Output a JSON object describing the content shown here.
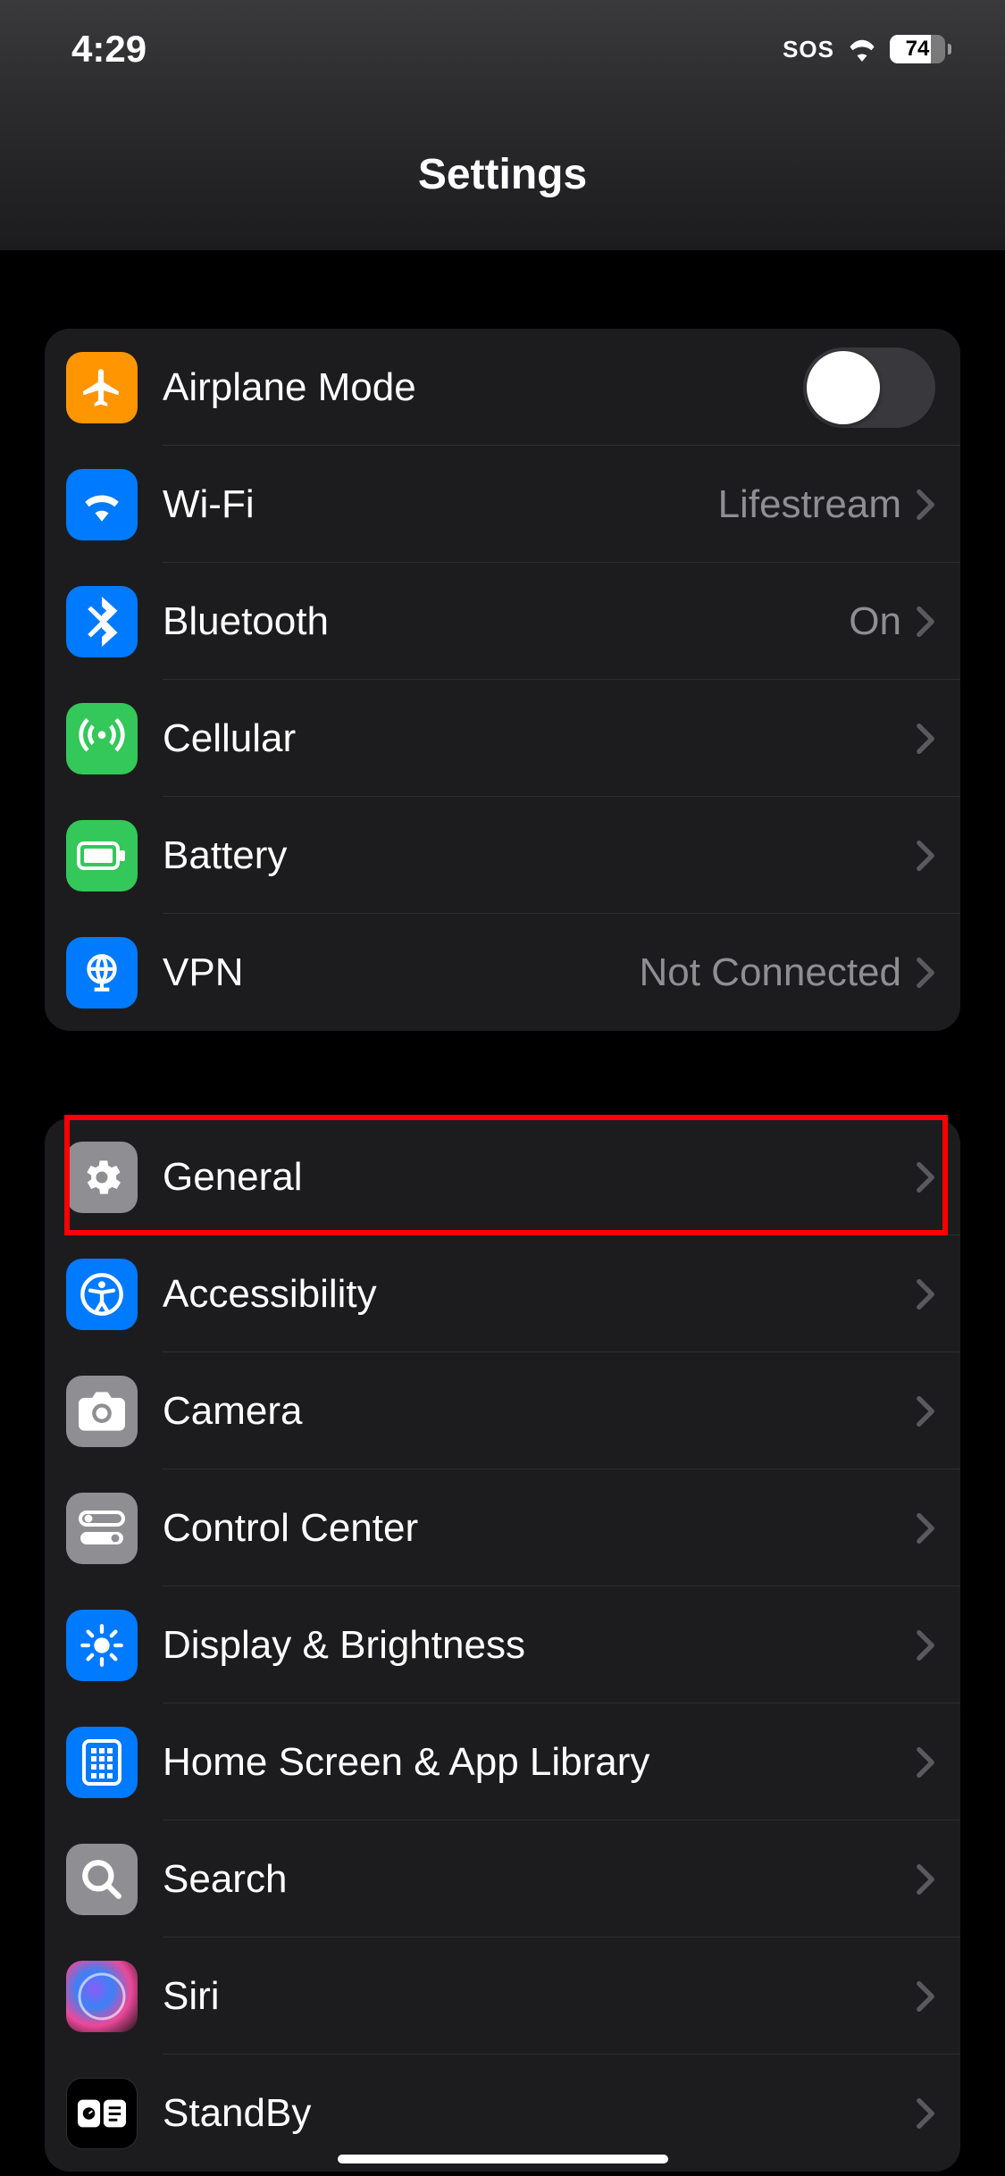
{
  "status": {
    "time": "4:29",
    "sos": "SOS",
    "battery": "74"
  },
  "header": {
    "title": "Settings"
  },
  "groups": [
    {
      "id": "connectivity",
      "rows": [
        {
          "key": "airplane",
          "label": "Airplane Mode",
          "value": "",
          "type": "toggle",
          "icon": "airplane",
          "color": "orange"
        },
        {
          "key": "wifi",
          "label": "Wi-Fi",
          "value": "Lifestream",
          "type": "disclose",
          "icon": "wifi",
          "color": "blue"
        },
        {
          "key": "bluetooth",
          "label": "Bluetooth",
          "value": "On",
          "type": "disclose",
          "icon": "bluetooth",
          "color": "blue"
        },
        {
          "key": "cellular",
          "label": "Cellular",
          "value": "",
          "type": "disclose",
          "icon": "antenna",
          "color": "green"
        },
        {
          "key": "battery",
          "label": "Battery",
          "value": "",
          "type": "disclose",
          "icon": "battery",
          "color": "green"
        },
        {
          "key": "vpn",
          "label": "VPN",
          "value": "Not Connected",
          "type": "disclose",
          "icon": "globe",
          "color": "blue"
        }
      ]
    },
    {
      "id": "system",
      "rows": [
        {
          "key": "general",
          "label": "General",
          "value": "",
          "type": "disclose",
          "icon": "gear",
          "color": "gray",
          "highlight": true
        },
        {
          "key": "accessibility",
          "label": "Accessibility",
          "value": "",
          "type": "disclose",
          "icon": "accessibility",
          "color": "blue"
        },
        {
          "key": "camera",
          "label": "Camera",
          "value": "",
          "type": "disclose",
          "icon": "camera",
          "color": "gray"
        },
        {
          "key": "controlcenter",
          "label": "Control Center",
          "value": "",
          "type": "disclose",
          "icon": "switches",
          "color": "gray"
        },
        {
          "key": "display",
          "label": "Display & Brightness",
          "value": "",
          "type": "disclose",
          "icon": "sun",
          "color": "blue"
        },
        {
          "key": "homescreen",
          "label": "Home Screen & App Library",
          "value": "",
          "type": "disclose",
          "icon": "apps",
          "color": "blue"
        },
        {
          "key": "search",
          "label": "Search",
          "value": "",
          "type": "disclose",
          "icon": "search",
          "color": "gray"
        },
        {
          "key": "siri",
          "label": "Siri",
          "value": "",
          "type": "disclose",
          "icon": "siri",
          "color": "siri"
        },
        {
          "key": "standby",
          "label": "StandBy",
          "value": "",
          "type": "disclose",
          "icon": "standby",
          "color": "black"
        }
      ]
    }
  ]
}
